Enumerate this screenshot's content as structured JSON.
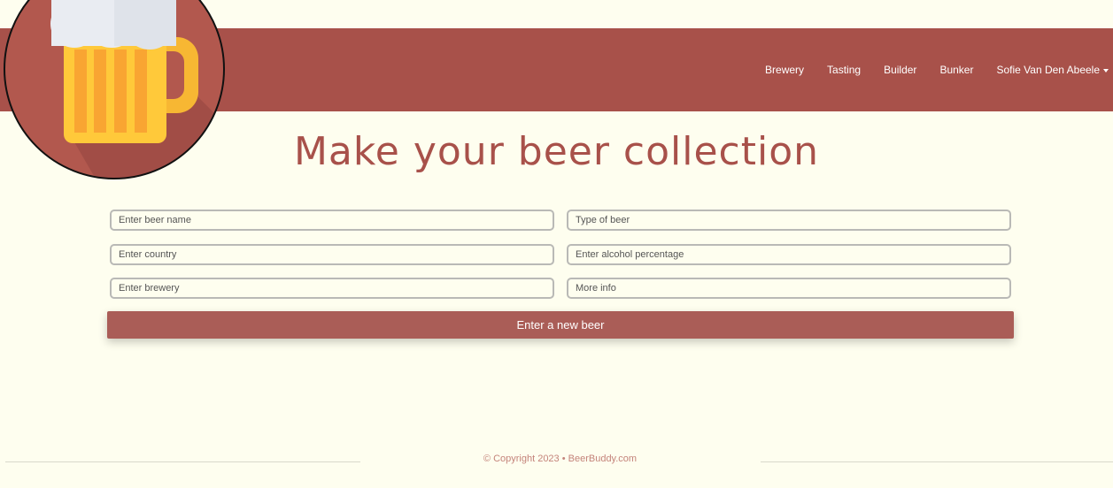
{
  "nav": {
    "items": [
      "Brewery",
      "Tasting",
      "Builder",
      "Bunker"
    ],
    "user": "Sofie Van Den Abeele"
  },
  "logo": {
    "icon": "beer-mug-icon"
  },
  "main": {
    "title": "Make your beer collection",
    "fields": {
      "beer_name": {
        "placeholder": "Enter beer name",
        "value": ""
      },
      "beer_type": {
        "placeholder": "Type of beer",
        "value": ""
      },
      "country": {
        "placeholder": "Enter country",
        "value": ""
      },
      "alcohol": {
        "placeholder": "Enter alcohol percentage",
        "value": ""
      },
      "brewery": {
        "placeholder": "Enter brewery",
        "value": ""
      },
      "more_info": {
        "placeholder": "More info",
        "value": ""
      }
    },
    "submit_label": "Enter a new beer"
  },
  "footer": {
    "text": "© Copyright 2023 • BeerBuddy.com"
  },
  "colors": {
    "brand": "#a8514a",
    "background": "#fefeef",
    "button": "#aa5d57"
  }
}
